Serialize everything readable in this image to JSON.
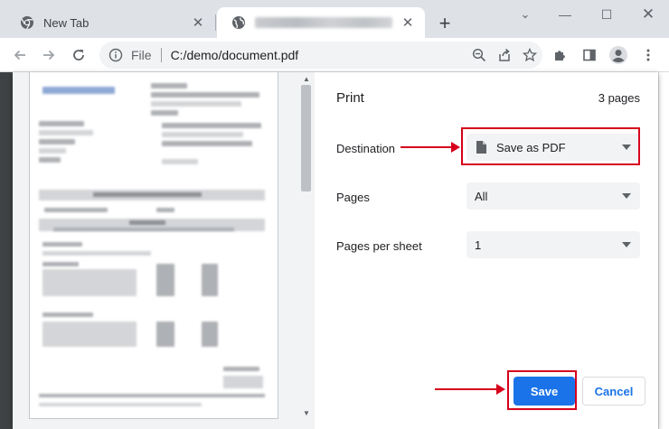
{
  "tabs": [
    {
      "title": "New Tab",
      "icon": "chrome-icon"
    },
    {
      "title": "",
      "icon": "globe-icon",
      "blurred": true
    }
  ],
  "window": {
    "chevron": "⌄",
    "minimize": "—",
    "maximize": "☐",
    "close": "✕"
  },
  "omnibox": {
    "scheme": "File",
    "url": "C:/demo/document.pdf"
  },
  "print": {
    "title": "Print",
    "page_count": "3 pages",
    "destination": {
      "label": "Destination",
      "value": "Save as PDF"
    },
    "pages": {
      "label": "Pages",
      "value": "All"
    },
    "pages_per_sheet": {
      "label": "Pages per sheet",
      "value": "1"
    },
    "save_label": "Save",
    "cancel_label": "Cancel"
  },
  "colors": {
    "accent": "#1a73e8",
    "annotation": "#d6001c",
    "scrim": "#525659"
  }
}
